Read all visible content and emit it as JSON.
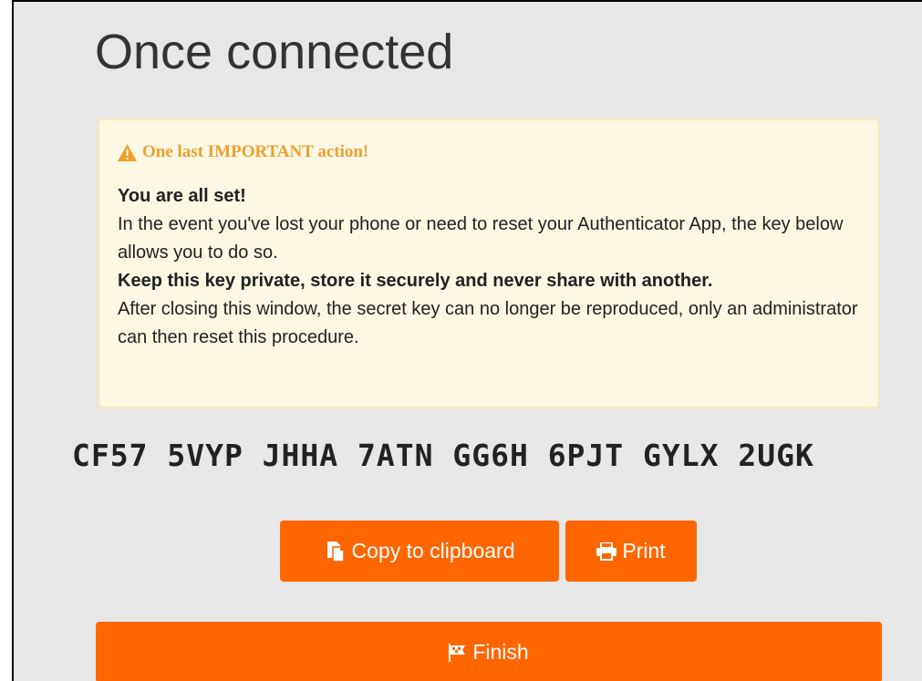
{
  "page": {
    "title": "Once connected"
  },
  "alert": {
    "icon": "warning-icon",
    "heading": "One last IMPORTANT action!",
    "line_set": "You are all set!",
    "line_event": "In the event you've lost your phone or need to reset your Authenticator App, the key below allows you to do so.",
    "line_private": "Keep this key private, store it securely and never share with another.",
    "line_after": "After closing this window, the secret key can no longer be reproduced, only an administrator can then reset this procedure."
  },
  "secret_key": "CF57 5VYP JHHA 7ATN GG6H 6PJT GYLX 2UGK",
  "actions": {
    "copy_label": "Copy to clipboard",
    "copy_icon": "copy-icon",
    "print_label": "Print",
    "print_icon": "print-icon",
    "finish_label": "Finish",
    "finish_icon": "flag-icon"
  },
  "colors": {
    "accent": "#ff6600",
    "alert_bg": "#fcf8e4",
    "alert_border": "#f8e9b9",
    "warning": "#ef9f2e",
    "page_bg": "#e7e7e7"
  }
}
